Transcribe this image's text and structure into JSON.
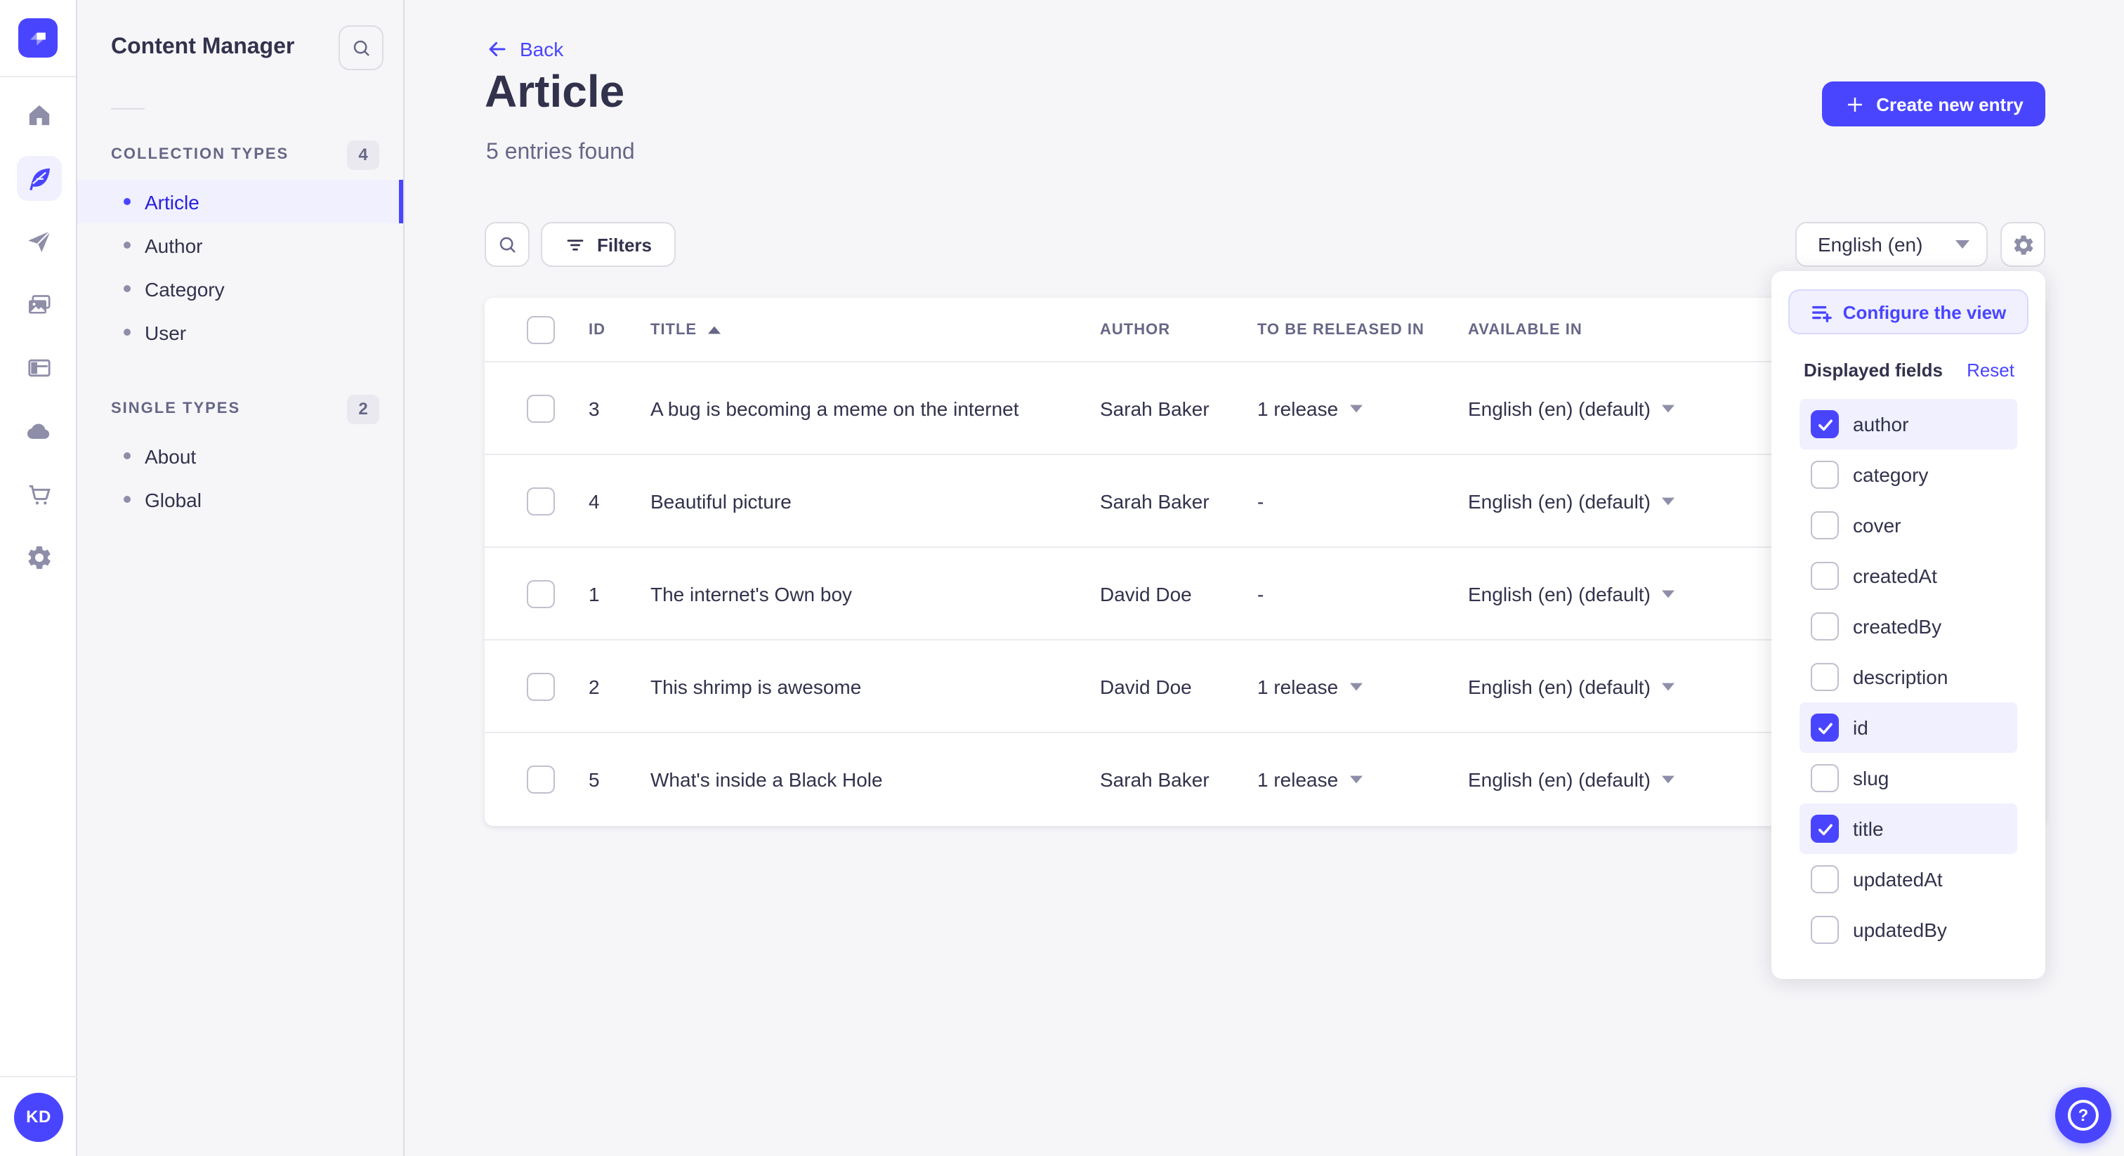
{
  "colors": {
    "primary": "#4945ff",
    "primary_dark_text": "#271fe0",
    "primary_light_bg": "#f0f0ff",
    "primary_border": "#d9d8ff",
    "text_dark": "#32324d",
    "text_gray": "#666687",
    "icon_gray": "#8e8ea9",
    "border_light": "#eaeaef",
    "border_input": "#dcdce4",
    "app_bg": "#f6f6f9",
    "panel_bg": "#ffffff"
  },
  "nav": {
    "logo": "strapi-logo",
    "icons": [
      "home-icon",
      "content-manager-icon",
      "releases-icon",
      "media-library-icon",
      "content-type-builder-icon",
      "deploy-icon",
      "marketplace-icon",
      "settings-icon"
    ],
    "active_icon": "content-manager-icon",
    "avatar_initials": "KD"
  },
  "subnav": {
    "title": "Content Manager",
    "sections": [
      {
        "label": "COLLECTION TYPES",
        "badge": "4",
        "items": [
          {
            "label": "Article",
            "active": true
          },
          {
            "label": "Author",
            "active": false
          },
          {
            "label": "Category",
            "active": false
          },
          {
            "label": "User",
            "active": false
          }
        ]
      },
      {
        "label": "SINGLE TYPES",
        "badge": "2",
        "items": [
          {
            "label": "About",
            "active": false
          },
          {
            "label": "Global",
            "active": false
          }
        ]
      }
    ]
  },
  "header": {
    "back_label": "Back",
    "title": "Article",
    "subtitle": "5 entries found",
    "create_button_label": "Create new entry"
  },
  "toolbar": {
    "filters_label": "Filters",
    "locale_value": "English (en)"
  },
  "table": {
    "columns": [
      "ID",
      "TITLE",
      "AUTHOR",
      "TO BE RELEASED IN",
      "AVAILABLE IN"
    ],
    "sorted_column": "TITLE",
    "sort_direction": "ascending",
    "rows": [
      {
        "id": "3",
        "title": "A bug is becoming a meme on the internet",
        "author": "Sarah Baker",
        "released": "1 release",
        "available": "English (en) (default)"
      },
      {
        "id": "4",
        "title": "Beautiful picture",
        "author": "Sarah Baker",
        "released": "-",
        "available": "English (en) (default)"
      },
      {
        "id": "1",
        "title": "The internet's Own boy",
        "author": "David Doe",
        "released": "-",
        "available": "English (en) (default)"
      },
      {
        "id": "2",
        "title": "This shrimp is awesome",
        "author": "David Doe",
        "released": "1 release",
        "available": "English (en) (default)"
      },
      {
        "id": "5",
        "title": "What's inside a Black Hole",
        "author": "Sarah Baker",
        "released": "1 release",
        "available": "English (en) (default)"
      }
    ]
  },
  "popover": {
    "configure_button_label": "Configure the view",
    "section_title": "Displayed fields",
    "reset_label": "Reset",
    "fields": [
      {
        "label": "author",
        "checked": true
      },
      {
        "label": "category",
        "checked": false
      },
      {
        "label": "cover",
        "checked": false
      },
      {
        "label": "createdAt",
        "checked": false
      },
      {
        "label": "createdBy",
        "checked": false
      },
      {
        "label": "description",
        "checked": false
      },
      {
        "label": "id",
        "checked": true
      },
      {
        "label": "slug",
        "checked": false
      },
      {
        "label": "title",
        "checked": true
      },
      {
        "label": "updatedAt",
        "checked": false
      },
      {
        "label": "updatedBy",
        "checked": false
      }
    ]
  },
  "help": {
    "icon": "question-mark-icon"
  }
}
